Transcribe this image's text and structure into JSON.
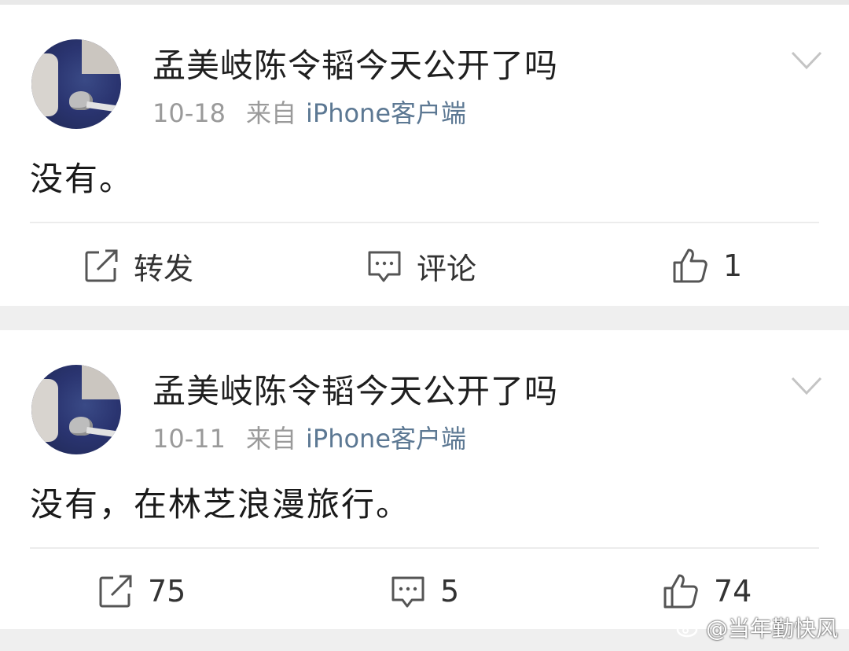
{
  "posts": [
    {
      "username": "孟美岐陈令韬今天公开了吗",
      "date": "10-18",
      "source_label": "来自",
      "source_device": "iPhone客户端",
      "text": "没有。",
      "repost_label": "转发",
      "comment_label": "评论",
      "like_count": "1"
    },
    {
      "username": "孟美岐陈令韬今天公开了吗",
      "date": "10-11",
      "source_label": "来自",
      "source_device": "iPhone客户端",
      "text": "没有，在林芝浪漫旅行。",
      "repost_label": "75",
      "comment_label": "5",
      "like_count": "74"
    }
  ],
  "icons": {
    "avatar": "avatar-photo",
    "menu": "chevron-down-icon",
    "repost": "repost-icon",
    "comment": "comment-icon",
    "like": "thumbs-up-icon"
  },
  "watermark": {
    "text": "@当年勤快风"
  },
  "colors": {
    "source_link": "#5c7893",
    "muted_text": "#9a9a9a",
    "background": "#efefef",
    "card": "#ffffff"
  }
}
